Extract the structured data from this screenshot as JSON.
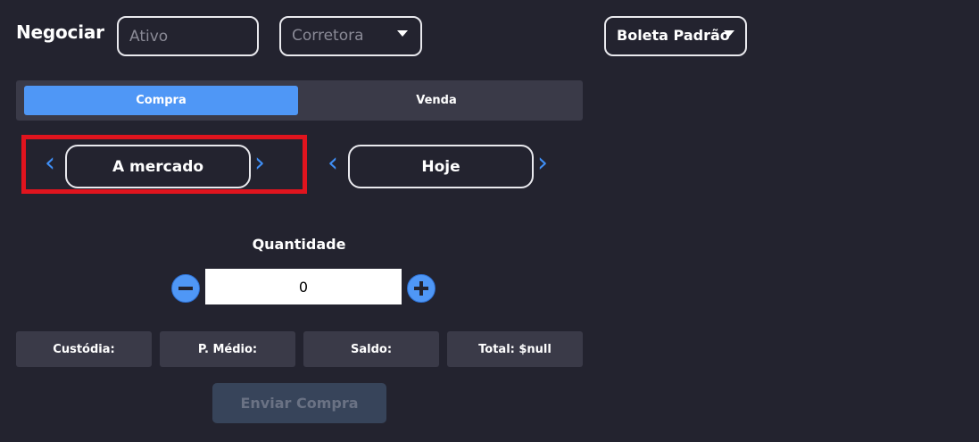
{
  "header": {
    "title": "Negociar",
    "ativo_placeholder": "Ativo",
    "corretora_label": "Corretora",
    "boleta_label": "Boleta Padrão"
  },
  "tabs": {
    "compra": "Compra",
    "venda": "Venda"
  },
  "order": {
    "type_value": "A mercado",
    "validity_value": "Hoje"
  },
  "quantity": {
    "label": "Quantidade",
    "value": "0"
  },
  "stats": {
    "custodia": "Custódia:",
    "preco_medio": "P. Médio:",
    "saldo": "Saldo:",
    "total": "Total: $null"
  },
  "submit_label": "Enviar Compra",
  "colors": {
    "background": "#23232f",
    "accent": "#4f97f6",
    "panel": "#3a3a48",
    "highlight": "#e0141e"
  }
}
